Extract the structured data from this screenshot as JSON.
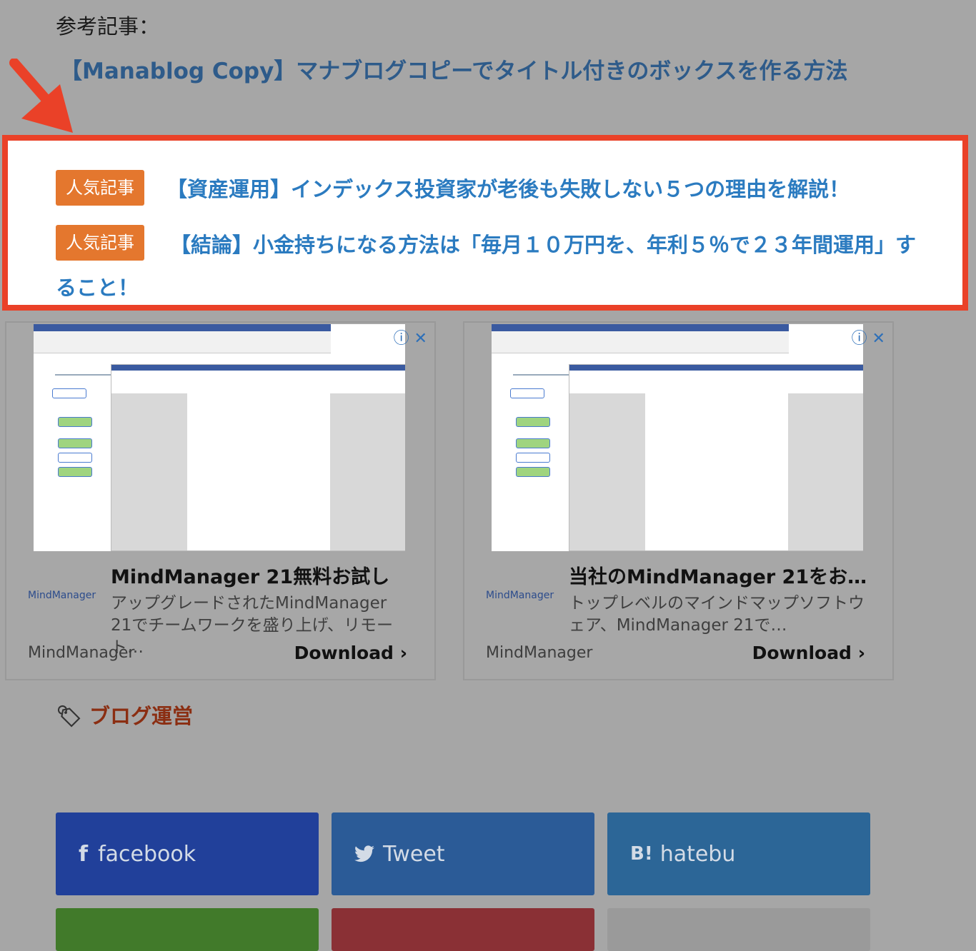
{
  "ref_label": "参考記事：",
  "ref_link": "【Manablog Copy】マナブログコピーでタイトル付きのボックスを作る方法",
  "popular": [
    {
      "badge": "人気記事",
      "text": "【資産運用】インデックス投資家が老後も失敗しない５つの理由を解説！"
    },
    {
      "badge": "人気記事",
      "text": "【結論】小金持ちになる方法は「毎月１０万円を、年利５％で２３年間運用」すること！"
    }
  ],
  "ads": [
    {
      "title": "MindManager 21無料お試し",
      "logo": "MindManager",
      "desc": "アップグレードされたMindManager 21でチームワークを盛り上げ、リモート…",
      "brand": "MindManager",
      "cta": "Download"
    },
    {
      "title": "当社のMindManager 21をお…",
      "logo": "MindManager",
      "desc": "トップレベルのマインドマップソフトウェア、MindManager 21で…",
      "brand": "MindManager",
      "cta": "Download"
    }
  ],
  "tag": "ブログ運営",
  "share": [
    {
      "label": "facebook",
      "icon": "f",
      "color": "#21409a"
    },
    {
      "label": "Tweet",
      "icon": "bird",
      "color": "#2b5b97"
    },
    {
      "label": "hatebu",
      "icon": "B!",
      "color": "#2c6697"
    },
    {
      "label": "",
      "color": "#417a2a"
    },
    {
      "label": "",
      "color": "#8a3035"
    },
    {
      "label": "",
      "color": "#9a9a9a"
    }
  ]
}
